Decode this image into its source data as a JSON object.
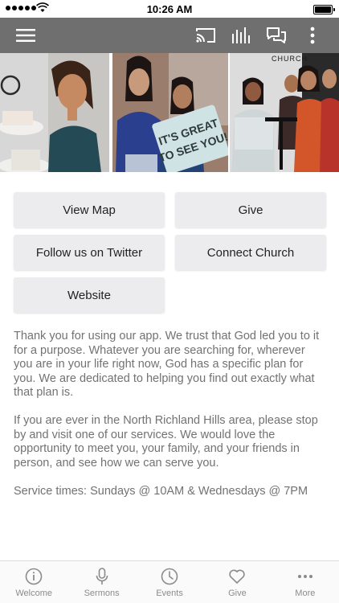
{
  "status_bar": {
    "time": "10:26 AM"
  },
  "nav": {
    "icons": [
      "menu-icon",
      "cast-icon",
      "audio-bars-icon",
      "chat-icon",
      "more-vertical-icon"
    ]
  },
  "hero": {
    "photo_text": {
      "sign": "IT'S GREAT TO SEE YOU!",
      "wall": "CHURCH"
    }
  },
  "buttons": {
    "view_map": "View Map",
    "give": "Give",
    "twitter": "Follow us on Twitter",
    "connect": "Connect Church",
    "website": "Website"
  },
  "description": {
    "p1": "Thank you for using our app. We trust that God led you to it for a purpose. Whatever you are searching for, wherever you are in your life right now, God has a specific plan for you. We are dedicated to helping you find out exactly what that plan is.",
    "p2": "If you are ever in the North Richland Hills area, please stop by and visit one of our services. We would love the opportunity to meet you, your family, and your friends in person, and see how we can serve you.",
    "p3": "Service times: Sundays @ 10AM & Wednesdays @ 7PM"
  },
  "tabs": [
    {
      "label": "Welcome",
      "icon": "info-icon"
    },
    {
      "label": "Sermons",
      "icon": "microphone-icon"
    },
    {
      "label": "Events",
      "icon": "clock-icon"
    },
    {
      "label": "Give",
      "icon": "heart-icon"
    },
    {
      "label": "More",
      "icon": "more-horizontal-icon"
    }
  ],
  "colors": {
    "nav_bar": "#6f6f6f",
    "button_bg": "#ececee",
    "text": "#727272",
    "tab_text": "#8b8b8b"
  }
}
